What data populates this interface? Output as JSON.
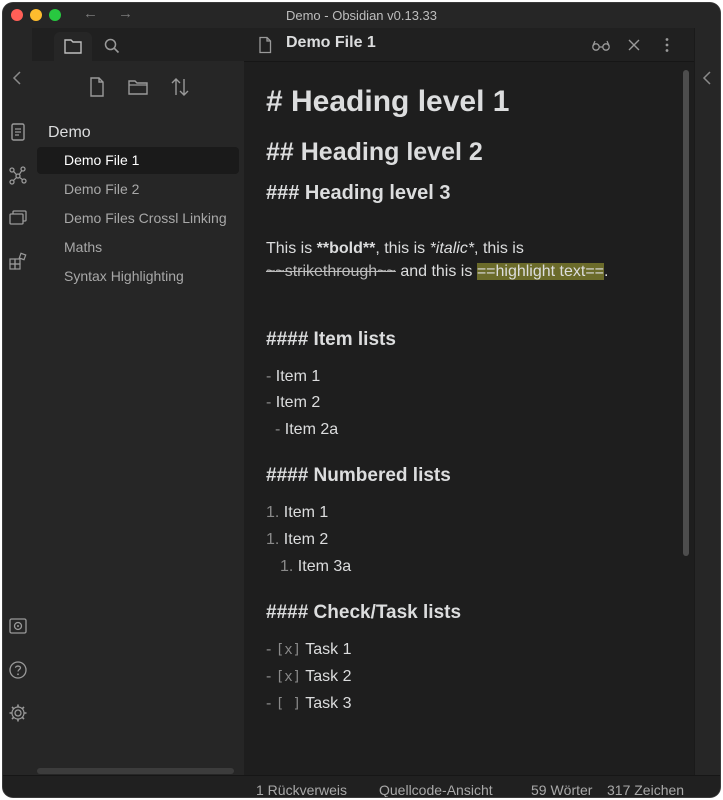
{
  "window": {
    "title": "Demo - Obsidian v0.13.33"
  },
  "titlebar": {
    "back_glyph": "←",
    "forward_glyph": "→"
  },
  "sidebar_tabs": {
    "active_icon": "folder-icon",
    "search_icon": "search-icon"
  },
  "nav_actions": [
    {
      "icon": "new-file-icon"
    },
    {
      "icon": "new-folder-icon"
    },
    {
      "icon": "sort-icon"
    }
  ],
  "vault": {
    "name": "Demo"
  },
  "files": [
    {
      "label": "Demo File 1",
      "active": true
    },
    {
      "label": "Demo File 2",
      "active": false
    },
    {
      "label": "Demo Files Crossl Linking",
      "active": false
    },
    {
      "label": "Maths",
      "active": false
    },
    {
      "label": "Syntax Highlighting",
      "active": false
    }
  ],
  "editor": {
    "title": "Demo File 1",
    "h1": "# Heading level 1",
    "h2": "## Heading level 2",
    "h3": "### Heading level 3",
    "para": {
      "t1": "This is ",
      "bold": "**bold**",
      "t2": ", this is ",
      "italic": "*italic*",
      "t3": ", this is",
      "strike": "~~strikethrough~~",
      "t4": " and this is ",
      "highlight": "==highlight text==",
      "t5": "."
    },
    "item_lists": {
      "heading": "#### Item lists",
      "items": [
        {
          "marker": "- ",
          "text": "Item 1"
        },
        {
          "marker": "- ",
          "text": "Item 2"
        },
        {
          "marker": "- ",
          "text": "Item 2a"
        }
      ]
    },
    "numbered_lists": {
      "heading": "#### Numbered lists",
      "items": [
        {
          "marker": "1. ",
          "text": "Item 1"
        },
        {
          "marker": "1. ",
          "text": "Item 2"
        },
        {
          "marker": "1. ",
          "text": "Item 3a"
        }
      ]
    },
    "task_lists": {
      "heading": "#### Check/Task lists",
      "items": [
        {
          "marker": "- ",
          "box": "[x]",
          "text": "Task 1"
        },
        {
          "marker": "- ",
          "box": "[x]",
          "text": "Task 2"
        },
        {
          "marker": "- ",
          "box": "[ ]",
          "text": "Task 3"
        }
      ]
    }
  },
  "status": {
    "backlinks": "1 Rückverweis",
    "mode": "Quellcode-Ansicht",
    "words": "59 Wörter",
    "chars": "317 Zeichen"
  }
}
